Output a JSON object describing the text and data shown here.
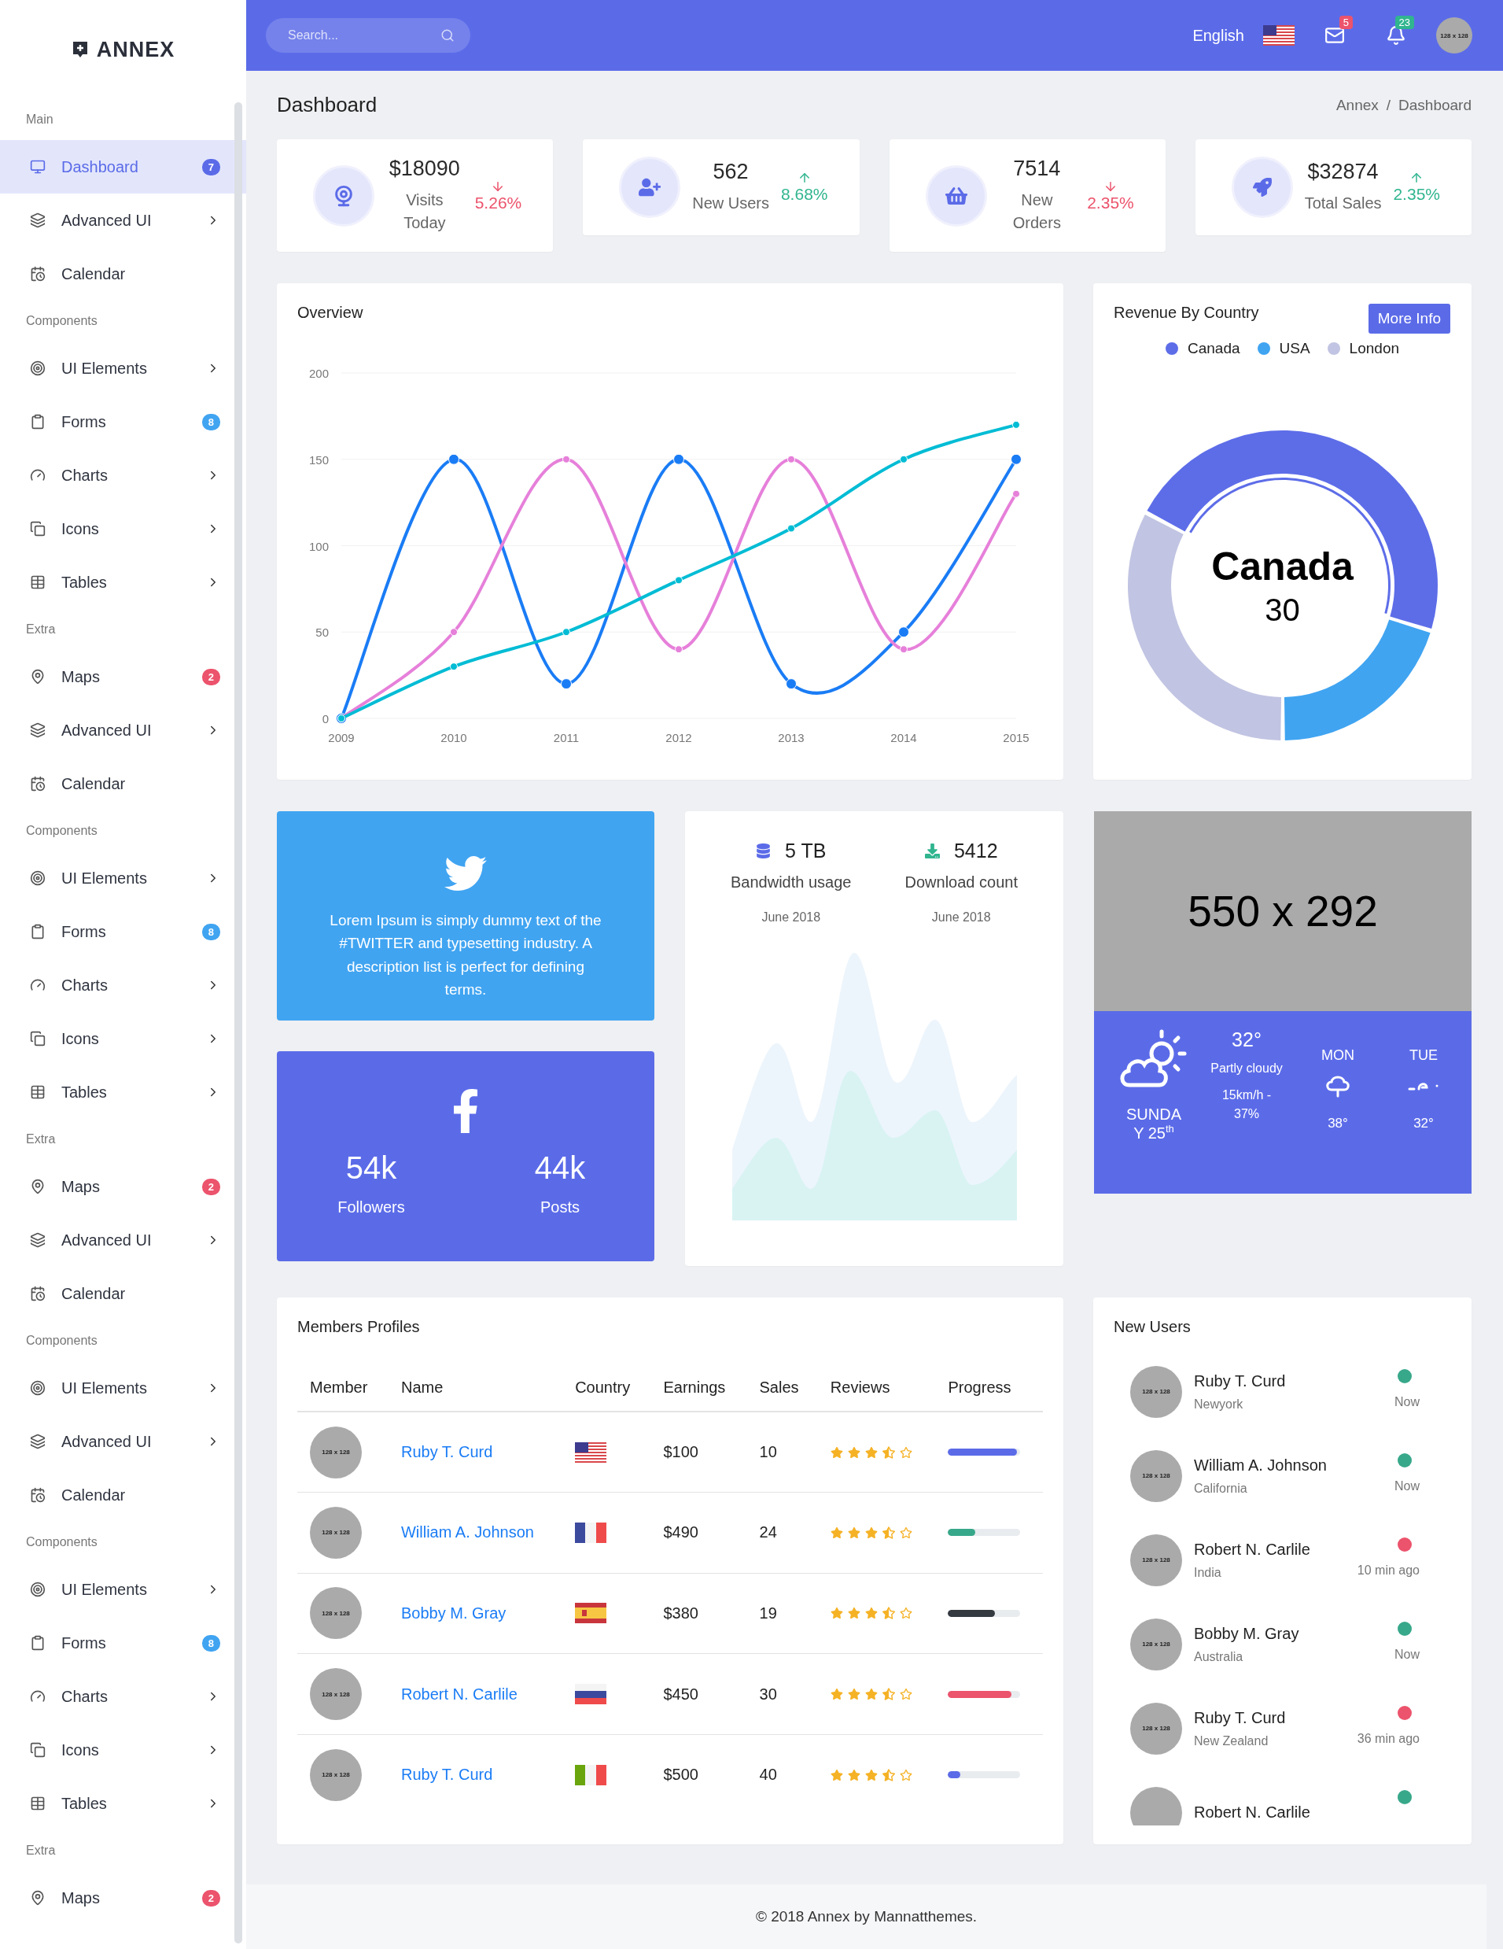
{
  "sidebar": {
    "logo": "ANNEX",
    "sections": [
      {
        "label": "Main",
        "items": [
          {
            "label": "Dashboard",
            "kind": "monitor",
            "badge": "7",
            "color": "#5b6be8",
            "submenu": false,
            "selected": true
          },
          {
            "label": "Advanced UI",
            "kind": "layers",
            "submenu": true,
            "selected": false
          },
          {
            "label": "Calendar",
            "kind": "calendar",
            "submenu": false,
            "selected": false
          }
        ]
      },
      {
        "label": "Components",
        "items": [
          {
            "label": "UI Elements",
            "kind": "target",
            "submenu": true,
            "selected": false
          },
          {
            "label": "Forms",
            "kind": "clipboard",
            "badge": "8",
            "color": "#40a4f1",
            "submenu": false,
            "selected": false
          },
          {
            "label": "Charts",
            "kind": "gauge",
            "submenu": true,
            "selected": false
          },
          {
            "label": "Icons",
            "kind": "cards",
            "submenu": true,
            "selected": false
          },
          {
            "label": "Tables",
            "kind": "table",
            "submenu": true,
            "selected": false
          }
        ]
      },
      {
        "label": "Extra",
        "items": [
          {
            "label": "Maps",
            "kind": "pin",
            "badge": "2",
            "color": "#ec536c",
            "submenu": false,
            "selected": false
          },
          {
            "label": "Advanced UI",
            "kind": "layers",
            "submenu": true,
            "selected": false
          },
          {
            "label": "Calendar",
            "kind": "calendar",
            "submenu": false,
            "selected": false
          }
        ]
      },
      {
        "label": "Components",
        "items": [
          {
            "label": "UI Elements",
            "kind": "target",
            "submenu": true,
            "selected": false
          },
          {
            "label": "Forms",
            "kind": "clipboard",
            "badge": "8",
            "color": "#40a4f1",
            "submenu": false,
            "selected": false
          },
          {
            "label": "Charts",
            "kind": "gauge",
            "submenu": true,
            "selected": false
          },
          {
            "label": "Icons",
            "kind": "cards",
            "submenu": true,
            "selected": false
          },
          {
            "label": "Tables",
            "kind": "table",
            "submenu": true,
            "selected": false
          }
        ]
      },
      {
        "label": "Extra",
        "items": [
          {
            "label": "Maps",
            "kind": "pin",
            "badge": "2",
            "color": "#ec536c",
            "submenu": false,
            "selected": false
          },
          {
            "label": "Advanced UI",
            "kind": "layers",
            "submenu": true,
            "selected": false
          },
          {
            "label": "Calendar",
            "kind": "calendar",
            "submenu": false,
            "selected": false
          }
        ]
      },
      {
        "label": "Components",
        "items": [
          {
            "label": "UI Elements",
            "kind": "target",
            "submenu": true,
            "selected": false
          },
          {
            "label": "Advanced UI",
            "kind": "layers",
            "submenu": true,
            "selected": false
          },
          {
            "label": "Calendar",
            "kind": "calendar",
            "submenu": false,
            "selected": false
          }
        ]
      },
      {
        "label": "Components",
        "items": [
          {
            "label": "UI Elements",
            "kind": "target",
            "submenu": true,
            "selected": false
          },
          {
            "label": "Forms",
            "kind": "clipboard",
            "badge": "8",
            "color": "#40a4f1",
            "submenu": false,
            "selected": false
          },
          {
            "label": "Charts",
            "kind": "gauge",
            "submenu": true,
            "selected": false
          },
          {
            "label": "Icons",
            "kind": "cards",
            "submenu": true,
            "selected": false
          },
          {
            "label": "Tables",
            "kind": "table",
            "submenu": true,
            "selected": false
          }
        ]
      },
      {
        "label": "Extra",
        "items": [
          {
            "label": "Maps",
            "kind": "pin",
            "badge": "2",
            "color": "#ec536c",
            "submenu": false,
            "selected": false
          }
        ]
      }
    ]
  },
  "topbar": {
    "search": {
      "placeholder": "Search..."
    },
    "language": "English",
    "notifications": [
      {
        "kind": "mail",
        "count": "5",
        "color": "#ec536c"
      },
      {
        "kind": "bell",
        "count": "23",
        "color": "#30b58f"
      }
    ],
    "avatar": "128 x 128"
  },
  "page": {
    "title": "Dashboard",
    "breadcrumb": {
      "items": [
        "Annex",
        "Dashboard"
      ],
      "separator": "/"
    }
  },
  "stats": [
    {
      "value": "$18090",
      "label": "Visits Today",
      "change": "5.26%",
      "kind": "down"
    },
    {
      "value": "562",
      "label": "New Users",
      "change": "8.68%",
      "kind": "up"
    },
    {
      "value": "7514",
      "label": "New Orders",
      "change": "2.35%",
      "kind": "down"
    },
    {
      "value": "$32874",
      "label": "Total Sales",
      "change": "2.35%",
      "kind": "up"
    }
  ],
  "overview": {
    "title": "Overview",
    "chart_data": {
      "type": "line",
      "grid": true,
      "x": [
        "2009",
        "2010",
        "2011",
        "2012",
        "2013",
        "2014",
        "2015"
      ],
      "ylim": [
        0,
        200
      ],
      "yticks": [
        0,
        50,
        100,
        150,
        200
      ],
      "series": [
        {
          "color": "#1a7cf5",
          "marker": true,
          "values": [
            0,
            150,
            20,
            150,
            20,
            50,
            150
          ]
        },
        {
          "color": "#e680da",
          "marker": true,
          "values": [
            0,
            50,
            150,
            40,
            150,
            40,
            130
          ]
        },
        {
          "color": "#00bcd4",
          "marker": true,
          "values": [
            0,
            30,
            50,
            80,
            110,
            150,
            170
          ]
        }
      ]
    }
  },
  "revenue": {
    "title": "Revenue By Country",
    "button": "More Info",
    "legend": [
      {
        "label": "Canada",
        "color": "#5d6de8"
      },
      {
        "label": "USA",
        "color": "#40a4f1"
      },
      {
        "label": "London",
        "color": "#c1c4e2"
      }
    ],
    "center_title": "Canada",
    "center_value": "30"
  },
  "twitter": {
    "text": "Lorem Ipsum is simply dummy text of the #TWITTER and typesetting industry. A description list is perfect for defining terms."
  },
  "facebook": {
    "stats": [
      {
        "value": "54k",
        "label": "Followers"
      },
      {
        "value": "44k",
        "label": "Posts"
      }
    ]
  },
  "usage": {
    "stats": [
      {
        "value": "5 TB",
        "label": "Bandwidth usage",
        "date": "June 2018"
      },
      {
        "value": "5412",
        "label": "Download count",
        "date": "June 2018"
      }
    ]
  },
  "weather": {
    "image": "550 x 292",
    "day": "SUNDAY 25$^{th}$",
    "temp": "32°",
    "condition": "Partly cloudy",
    "wind": "15km/h - 37%",
    "forecast": [
      {
        "day": "MON",
        "temp": "38°"
      },
      {
        "day": "TUE",
        "temp": "32°"
      }
    ]
  },
  "members": {
    "title": "Members Profiles",
    "columns": [
      "Member",
      "Name",
      "Country",
      "Earnings",
      "Sales",
      "Reviews",
      "Progress"
    ],
    "rows": [
      {
        "avatar": "128 x 128",
        "name": "Ruby T. Curd",
        "kind": "us",
        "earnings": "$100",
        "sales": "10",
        "stars": 3.5,
        "progress": {
          "level": 0.95,
          "color": "#5b6be8"
        }
      },
      {
        "avatar": "128 x 128",
        "name": "William A. Johnson",
        "kind": "fr",
        "earnings": "$490",
        "sales": "24",
        "stars": 3.5,
        "progress": {
          "level": 0.38,
          "color": "#38a88a"
        }
      },
      {
        "avatar": "128 x 128",
        "name": "Bobby M. Gray",
        "kind": "es",
        "earnings": "$380",
        "sales": "19",
        "stars": 3.5,
        "progress": {
          "level": 0.65,
          "color": "#343a40"
        }
      },
      {
        "avatar": "128 x 128",
        "name": "Robert N. Carlile",
        "kind": "ru",
        "earnings": "$450",
        "sales": "30",
        "stars": 3.5,
        "progress": {
          "level": 0.88,
          "color": "#ec536c"
        }
      },
      {
        "avatar": "128 x 128",
        "name": "Ruby T. Curd",
        "kind": "it",
        "earnings": "$500",
        "sales": "40",
        "stars": 3.5,
        "progress": {
          "level": 0.17,
          "color": "#5b6be8"
        }
      }
    ]
  },
  "new_users": {
    "title": "New Users",
    "items": [
      {
        "avatar": "128 x 128",
        "name": "Ruby T. Curd",
        "place": "Newyork",
        "color": "#38a88a",
        "time": "Now"
      },
      {
        "avatar": "128 x 128",
        "name": "William A. Johnson",
        "place": "California",
        "color": "#38a88a",
        "time": "Now"
      },
      {
        "avatar": "128 x 128",
        "name": "Robert N. Carlile",
        "place": "India",
        "color": "#ec536c",
        "time": "10 min ago"
      },
      {
        "avatar": "128 x 128",
        "name": "Bobby M. Gray",
        "place": "Australia",
        "color": "#38a88a",
        "time": "Now"
      },
      {
        "avatar": "128 x 128",
        "name": "Ruby T. Curd",
        "place": "New Zealand",
        "color": "#ec536c",
        "time": "36 min ago"
      },
      {
        "name": "Robert N. Carlile",
        "color": "#38a88a"
      }
    ]
  },
  "footer": "© 2018 Annex by Mannatthemes."
}
